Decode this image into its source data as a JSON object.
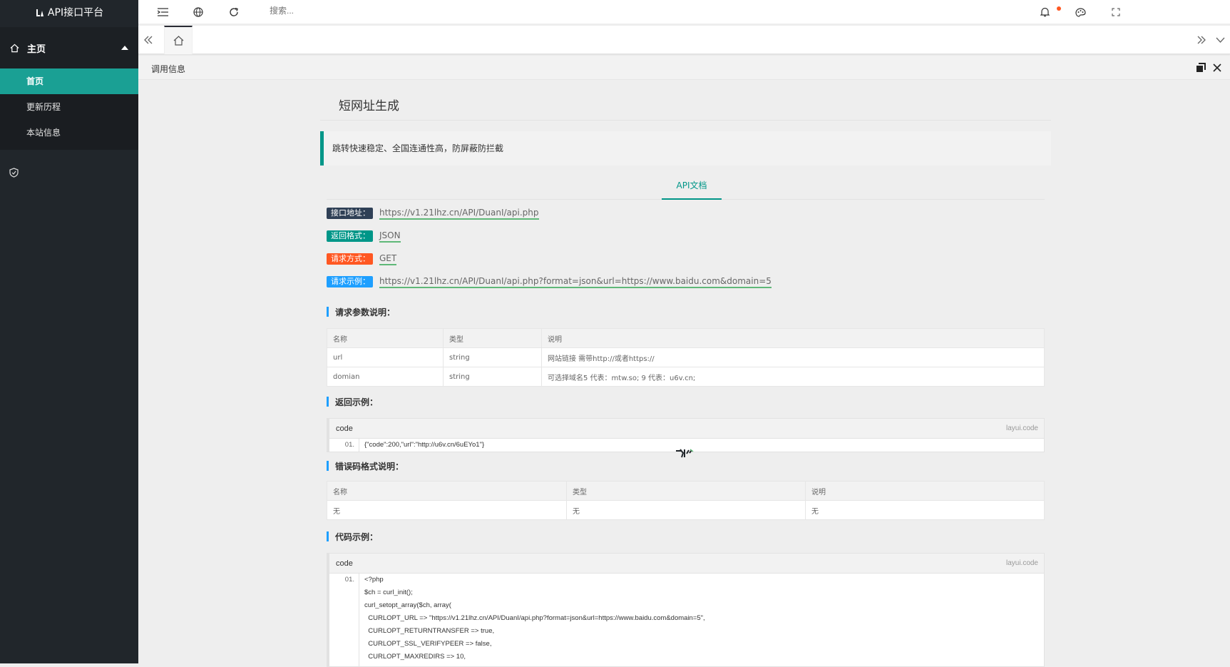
{
  "app": {
    "title": "API接口平台"
  },
  "sidebar": {
    "group_label": "主页",
    "items": [
      {
        "label": "首页",
        "active": true
      },
      {
        "label": "更新历程",
        "active": false
      },
      {
        "label": "本站信息",
        "active": false
      }
    ]
  },
  "topbar": {
    "search_placeholder": "搜索..."
  },
  "infobar": {
    "title": "调用信息"
  },
  "page": {
    "title": "短网址生成",
    "description": "跳转快速稳定、全国连通性高，防屏蔽防拦截",
    "tab": "API文档",
    "fields": [
      {
        "label": "接口地址：",
        "value": "https://v1.21lhz.cn/API/DuanI/api.php"
      },
      {
        "label": "返回格式：",
        "value": "JSON"
      },
      {
        "label": "请求方式：",
        "value": "GET"
      },
      {
        "label": "请求示例：",
        "value": "https://v1.21lhz.cn/API/DuanI/api.php?format=json&url=https://www.baidu.com&domain=5"
      }
    ],
    "params_title": "请求参数说明：",
    "params_headers": [
      "名称",
      "类型",
      "说明"
    ],
    "params_rows": [
      [
        "url",
        "string",
        "网站链接 需带http://或者https://"
      ],
      [
        "domian",
        "string",
        "可选择域名5 代表：mtw.so; 9 代表：u6v.cn;"
      ]
    ],
    "return_title": "返回示例：",
    "return_code": {
      "head": "code",
      "tag": "layui.code",
      "line_no": "01.",
      "lines": [
        "{\"code\":200,\"url\":\"http://u6v.cn/6uEYo1\"}"
      ]
    },
    "errors_title": "错误码格式说明：",
    "errors_headers": [
      "名称",
      "类型",
      "说明"
    ],
    "errors_rows": [
      [
        "无",
        "无",
        "无"
      ]
    ],
    "code_title": "代码示例：",
    "example_code": {
      "head": "code",
      "tag": "layui.code",
      "line_no": "01.",
      "lines": [
        "<?php",
        "$ch = curl_init();",
        "curl_setopt_array($ch, array(",
        "  CURLOPT_URL => \"https://v1.21lhz.cn/API/DuanI/api.php?format=json&url=https://www.baidu.com&domain=5\",",
        "  CURLOPT_RETURNTRANSFER => true,",
        "  CURLOPT_SSL_VERIFYPEER => false,",
        "  CURLOPT_MAXREDIRS => 10,"
      ]
    }
  },
  "colors": {
    "accent": "#009688",
    "sidebar": "#21262b",
    "active_item": "#1aa094"
  }
}
